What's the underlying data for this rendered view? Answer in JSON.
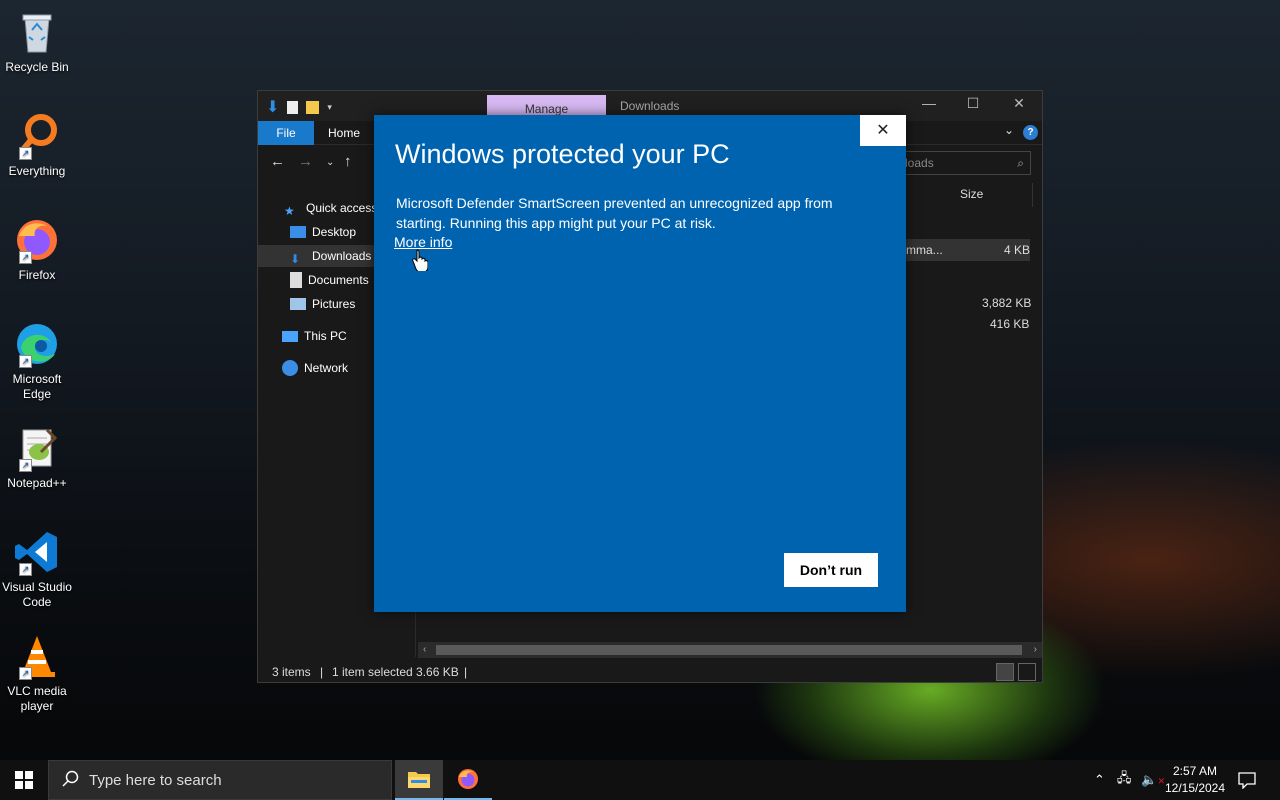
{
  "desktop": {
    "icons": [
      {
        "label": "Recycle Bin"
      },
      {
        "label": "Everything"
      },
      {
        "label": "Firefox"
      },
      {
        "label": "Microsoft Edge"
      },
      {
        "label": "Notepad++"
      },
      {
        "label": "Visual Studio Code"
      },
      {
        "label": "VLC media player"
      }
    ]
  },
  "explorer": {
    "manage_tab": "Manage",
    "title": "Downloads",
    "ribbon": {
      "file": "File",
      "home": "Home"
    },
    "search_placeholder": "loads",
    "columns": {
      "size": "Size"
    },
    "nav": {
      "quick_access": "Quick access",
      "desktop": "Desktop",
      "downloads": "Downloads",
      "documents": "Documents",
      "pictures": "Pictures",
      "this_pc": "This PC",
      "network": "Network"
    },
    "files": [
      {
        "name_fragment": "mma...",
        "size": "4 KB"
      },
      {
        "size": "3,882 KB"
      },
      {
        "size": "416 KB"
      }
    ],
    "status": {
      "items": "3 items",
      "selected": "1 item selected  3.66 KB"
    }
  },
  "smartscreen": {
    "title": "Windows protected your PC",
    "body": "Microsoft Defender SmartScreen prevented an unrecognized app from starting. Running this app might put your PC at risk.",
    "more_info": "More info",
    "dont_run": "Don’t run",
    "close": "✕"
  },
  "taskbar": {
    "search_placeholder": "Type here to search",
    "time": "2:57 AM",
    "date": "12/15/2024"
  },
  "colors": {
    "dialog_blue": "#0063af",
    "file_tab_blue": "#1979ca",
    "manage_tab": "#d7b8f2"
  }
}
